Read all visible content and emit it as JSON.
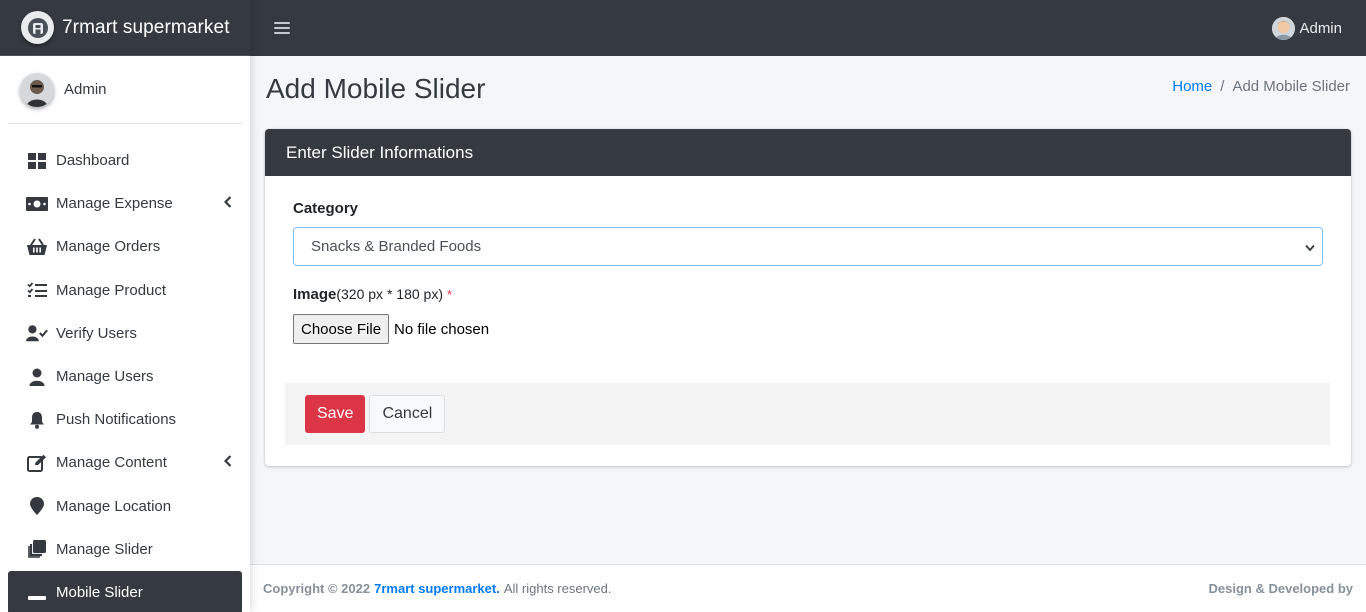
{
  "brand": {
    "name": "7rmart supermarket",
    "logo_icon": "brand-logo-icon"
  },
  "sidebar": {
    "user": {
      "name": "Admin"
    },
    "items": [
      {
        "label": "Dashboard",
        "icon": "dashboard-grid-icon",
        "has_caret": false
      },
      {
        "label": "Manage Expense",
        "icon": "money-bill-icon",
        "has_caret": true
      },
      {
        "label": "Manage Orders",
        "icon": "basket-icon",
        "has_caret": false
      },
      {
        "label": "Manage Product",
        "icon": "checklist-icon",
        "has_caret": false
      },
      {
        "label": "Verify Users",
        "icon": "user-check-icon",
        "has_caret": false
      },
      {
        "label": "Manage Users",
        "icon": "user-icon",
        "has_caret": false
      },
      {
        "label": "Push Notifications",
        "icon": "bell-icon",
        "has_caret": false
      },
      {
        "label": "Manage Content",
        "icon": "edit-icon",
        "has_caret": true
      },
      {
        "label": "Manage Location",
        "icon": "map-marker-icon",
        "has_caret": false
      },
      {
        "label": "Manage Slider",
        "icon": "clone-icon",
        "has_caret": false
      },
      {
        "label": "Mobile Slider",
        "icon": "minus-icon",
        "has_caret": false,
        "active": true
      }
    ]
  },
  "topbar": {
    "user_name": "Admin"
  },
  "page": {
    "title": "Add Mobile Slider",
    "breadcrumb": {
      "home": "Home",
      "separator": "/",
      "current": "Add Mobile Slider"
    }
  },
  "form": {
    "header": "Enter Slider Informations",
    "category_label": "Category",
    "category_value": "Snacks & Branded Foods",
    "image_label": "Image",
    "image_hint": "(320 px * 180 px)",
    "required_mark": "*",
    "file_button": "Choose File",
    "file_status": "No file chosen",
    "save_label": "Save",
    "cancel_label": "Cancel"
  },
  "footer": {
    "copyright": "Copyright © 2022",
    "brand_link": "7rmart supermarket.",
    "rights": "All rights reserved.",
    "credit": "Design & Developed by"
  },
  "colors": {
    "navbar_bg": "#343a40",
    "accent_link": "#007bff",
    "danger": "#dc3545",
    "content_bg": "#f4f6f9"
  }
}
